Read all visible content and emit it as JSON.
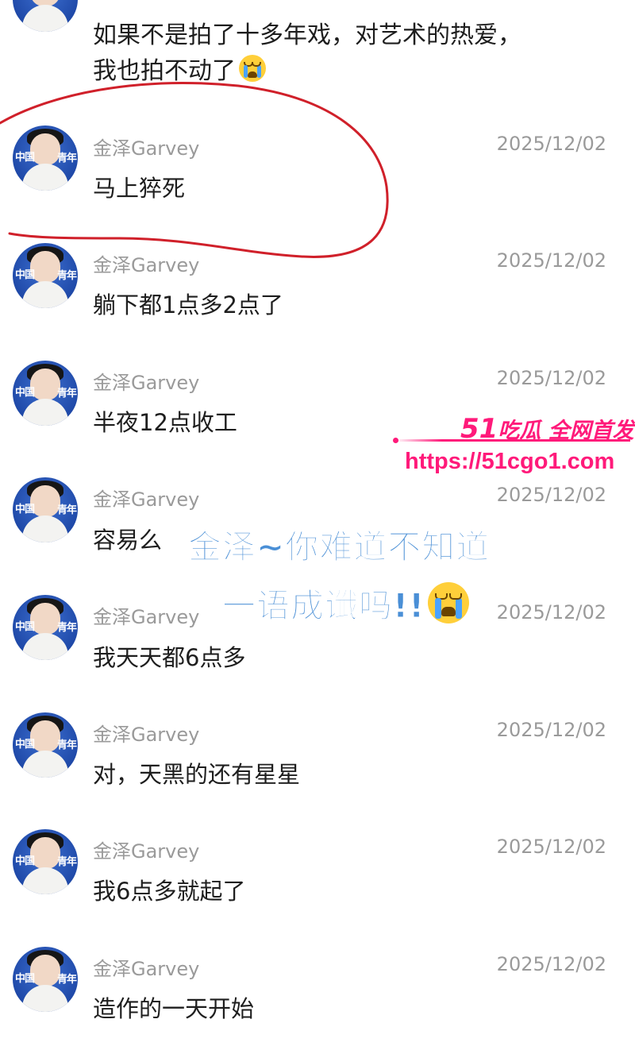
{
  "top_message": {
    "line1": "如果不是拍了十多年戏，对艺术的热爱，",
    "line2": "我也拍不动了"
  },
  "avatar_text": {
    "left": "中国",
    "right": "青年"
  },
  "comments": [
    {
      "name": "金泽Garvey",
      "time": "2025/12/02",
      "text": "马上猝死"
    },
    {
      "name": "金泽Garvey",
      "time": "2025/12/02",
      "text": "躺下都1点多2点了"
    },
    {
      "name": "金泽Garvey",
      "time": "2025/12/02",
      "text": "半夜12点收工"
    },
    {
      "name": "金泽Garvey",
      "time": "2025/12/02",
      "text": "容易么"
    },
    {
      "name": "金泽Garvey",
      "time": "2025/12/02",
      "text": "我天天都6点多"
    },
    {
      "name": "金泽Garvey",
      "time": "2025/12/02",
      "text": "对，天黑的还有星星"
    },
    {
      "name": "金泽Garvey",
      "time": "2025/12/02",
      "text": "我6点多就起了"
    },
    {
      "name": "金泽Garvey",
      "time": "2025/12/02",
      "text": "造作的一天开始"
    }
  ],
  "overlay": {
    "line1": "金泽~你难道不知道",
    "line2": "一语成谶吗!!"
  },
  "watermark": {
    "brand_num": "51",
    "brand_text": "吃瓜 全网首发",
    "url": "https://51cgo1.com"
  },
  "colors": {
    "annotation_loop": "#d0202a",
    "overlay_text": "#4a8fd6",
    "watermark": "#ff1a7a"
  }
}
